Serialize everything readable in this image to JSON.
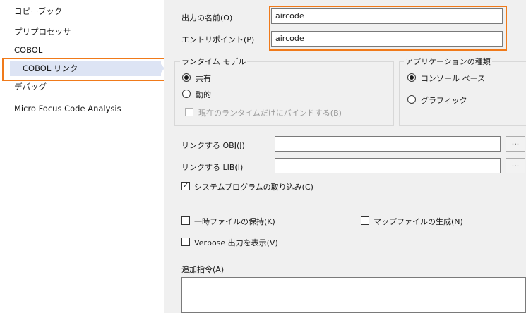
{
  "sidebar": {
    "items": [
      {
        "label": "コピーブック"
      },
      {
        "label": "プリプロセッサ"
      },
      {
        "label": "COBOL"
      },
      {
        "label": "COBOL リンク"
      },
      {
        "label": "デバッグ"
      },
      {
        "label": "Micro Focus Code Analysis"
      }
    ],
    "selected_index": 3
  },
  "form": {
    "output_name": {
      "label": "出力の名前(O)",
      "value": "aircode"
    },
    "entry_point": {
      "label": "エントリポイント(P)",
      "value": "aircode"
    },
    "runtime_model": {
      "legend": "ランタイム モデル",
      "options": [
        {
          "label": "共有",
          "selected": true
        },
        {
          "label": "動的",
          "selected": false
        }
      ],
      "bind_current": {
        "label": "現在のランタイムだけにバインドする(B)",
        "checked": false,
        "disabled": true
      }
    },
    "app_type": {
      "legend": "アプリケーションの種類",
      "options": [
        {
          "label": "コンソール ベース",
          "selected": true
        },
        {
          "label": "グラフィック",
          "selected": false
        }
      ]
    },
    "link_obj": {
      "label": "リンクする OBJ(J)",
      "value": "",
      "browse": "..."
    },
    "link_lib": {
      "label": "リンクする LIB(I)",
      "value": "",
      "browse": "..."
    },
    "include_system": {
      "label": "システムプログラムの取り込み(C)",
      "checked": true
    },
    "keep_temp": {
      "label": "一時ファイルの保持(K)",
      "checked": false
    },
    "generate_map": {
      "label": "マップファイルの生成(N)",
      "checked": false
    },
    "verbose": {
      "label": "Verbose 出力を表示(V)",
      "checked": false
    },
    "additional": {
      "label": "追加指令(A)",
      "value": ""
    }
  },
  "colors": {
    "highlight": "#f07a1a",
    "selection": "#dde4f4",
    "panel_bg": "#f0f0f0"
  }
}
